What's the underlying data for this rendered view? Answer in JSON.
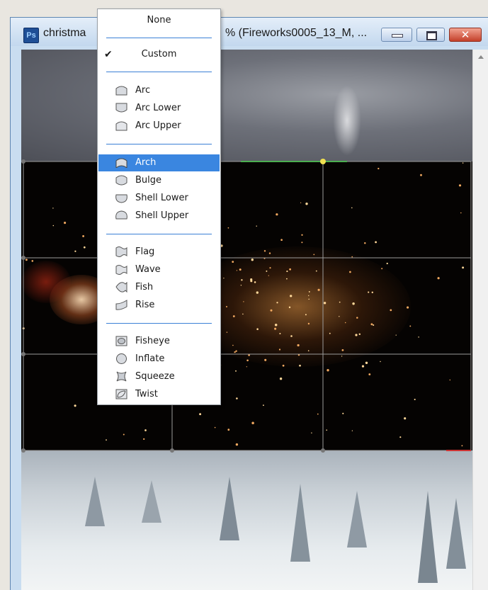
{
  "window": {
    "app_icon_label": "Ps",
    "title_left": "christma",
    "title_right": "% (Fireworks0005_13_M, ..."
  },
  "warp_menu": {
    "top_items": [
      {
        "label": "None",
        "checked": false
      },
      {
        "label": "Custom",
        "checked": true
      }
    ],
    "groups": [
      [
        {
          "label": "Arc",
          "icon": "arc-icon"
        },
        {
          "label": "Arc Lower",
          "icon": "arc-lower-icon"
        },
        {
          "label": "Arc Upper",
          "icon": "arc-upper-icon"
        }
      ],
      [
        {
          "label": "Arch",
          "icon": "arch-icon",
          "highlighted": true
        },
        {
          "label": "Bulge",
          "icon": "bulge-icon"
        },
        {
          "label": "Shell Lower",
          "icon": "shell-lower-icon"
        },
        {
          "label": "Shell Upper",
          "icon": "shell-upper-icon"
        }
      ],
      [
        {
          "label": "Flag",
          "icon": "flag-icon"
        },
        {
          "label": "Wave",
          "icon": "wave-icon"
        },
        {
          "label": "Fish",
          "icon": "fish-icon"
        },
        {
          "label": "Rise",
          "icon": "rise-icon"
        }
      ],
      [
        {
          "label": "Fisheye",
          "icon": "fisheye-icon"
        },
        {
          "label": "Inflate",
          "icon": "inflate-icon"
        },
        {
          "label": "Squeeze",
          "icon": "squeeze-icon"
        },
        {
          "label": "Twist",
          "icon": "twist-icon"
        }
      ]
    ],
    "highlight_color": "#3a86e0",
    "separator_color": "#3b80d6"
  }
}
